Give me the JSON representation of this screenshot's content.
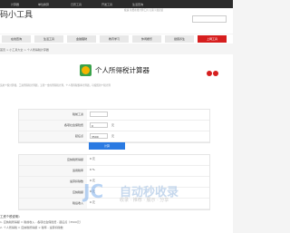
{
  "topbar": {
    "items": [
      "计算器",
      "单位换算",
      "日历工具",
      "开发工具",
      "生活查询"
    ]
  },
  "header": {
    "logo": "码小工具",
    "subtitle": "极速·免费在线计算工具·无需下载安装"
  },
  "nav": {
    "items": [
      "在线查询",
      "生活工具",
      "金融理财",
      "教育学习",
      "休闲娱乐",
      "健康养生",
      "上网工具"
    ],
    "active_index": 6
  },
  "breadcrumb": "首页 > 小工具大全 > 个人所得税计算器",
  "page": {
    "title": "个人所得税计算器",
    "description": "适用个税计算器，工资所得税计算器，五险一金的所得税计算，个人所得税税率计算器，可按照新个税计算"
  },
  "form": {
    "rows": [
      {
        "label": "税前工资",
        "value": ""
      },
      {
        "label": "各项社会保险费",
        "value": "0",
        "unit": "元"
      },
      {
        "label": "起征点",
        "value": "3500",
        "unit": "元"
      },
      {
        "label": "",
        "value": ""
      }
    ],
    "submit_label": "计算"
  },
  "results": {
    "rows": [
      {
        "label": "应纳税所得额",
        "value": "0 元"
      },
      {
        "label": "适用税率",
        "value": "0 %"
      },
      {
        "label": "速算扣除数",
        "value": "0 元"
      },
      {
        "label": "应纳税额",
        "value": "0 元"
      },
      {
        "label": "税后收入",
        "value": "0 元"
      }
    ]
  },
  "watermark": {
    "logo": "JC",
    "text": "自动秒收录",
    "sub": "收录 · 推荐 · 展示 · 分享"
  },
  "footer": {
    "title": "工资个税说明：",
    "line1": "1. 应纳税所得额 = 税前收入 - 各项社会保险费 - 起征点（3500元）",
    "line2": "2. 个人所得税 = 应纳税所得额 × 税率 - 速算扣除数"
  }
}
